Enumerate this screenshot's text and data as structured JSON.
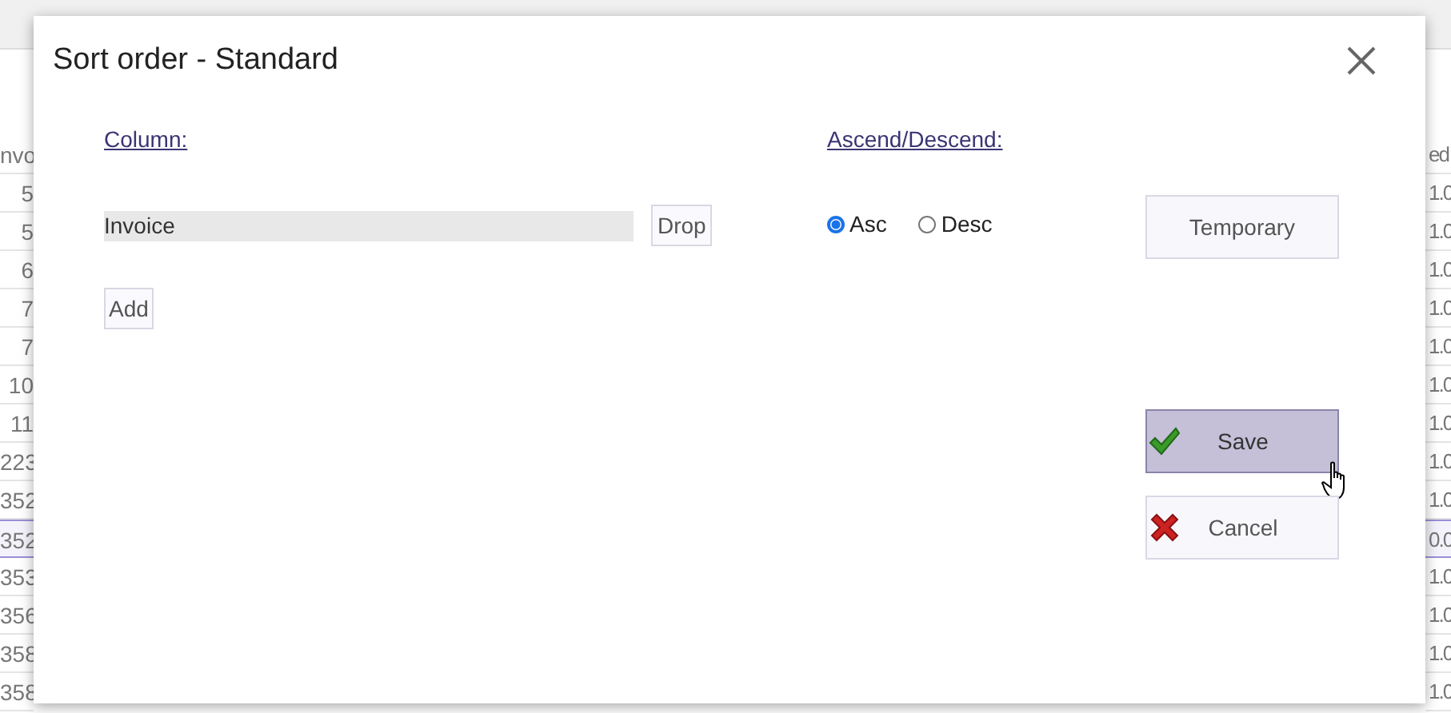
{
  "background_table": {
    "columns": [
      {
        "header": "nvo"
      },
      {
        "header": "ed"
      }
    ],
    "rows": [
      {
        "cells": [
          "5",
          "1.0"
        ],
        "selected": false
      },
      {
        "cells": [
          "5",
          "1.0"
        ],
        "selected": false
      },
      {
        "cells": [
          "6",
          "1.0"
        ],
        "selected": false
      },
      {
        "cells": [
          "7",
          "1.0"
        ],
        "selected": false
      },
      {
        "cells": [
          "7",
          "1.0"
        ],
        "selected": false
      },
      {
        "cells": [
          "10",
          "1.0"
        ],
        "selected": false
      },
      {
        "cells": [
          "11",
          "1.0"
        ],
        "selected": false
      },
      {
        "cells": [
          "223",
          "1.0"
        ],
        "selected": false
      },
      {
        "cells": [
          "352",
          "1.0"
        ],
        "selected": false
      },
      {
        "cells": [
          "352",
          "0.0"
        ],
        "selected": true
      },
      {
        "cells": [
          "353",
          "1.0"
        ],
        "selected": false
      },
      {
        "cells": [
          "356",
          "1.0"
        ],
        "selected": false
      },
      {
        "cells": [
          "358",
          "1.0"
        ],
        "selected": false
      },
      {
        "cells": [
          "358",
          "1.0"
        ],
        "selected": false
      }
    ]
  },
  "dialog": {
    "title": "Sort order - Standard",
    "column_label": "Column:",
    "sort_columns": [
      {
        "value": "Invoice",
        "drop_button": "Drop"
      }
    ],
    "add_button": "Add",
    "direction_label": "Ascend/Descend:",
    "directions": [
      {
        "label": "Asc",
        "selected": true
      },
      {
        "label": "Desc",
        "selected": false
      }
    ],
    "buttons": [
      {
        "kind": "plain",
        "label": "Temporary",
        "hovered": false
      },
      {
        "kind": "save",
        "label": "Save",
        "hovered": true
      },
      {
        "kind": "cancel",
        "label": "Cancel",
        "hovered": false
      }
    ]
  }
}
